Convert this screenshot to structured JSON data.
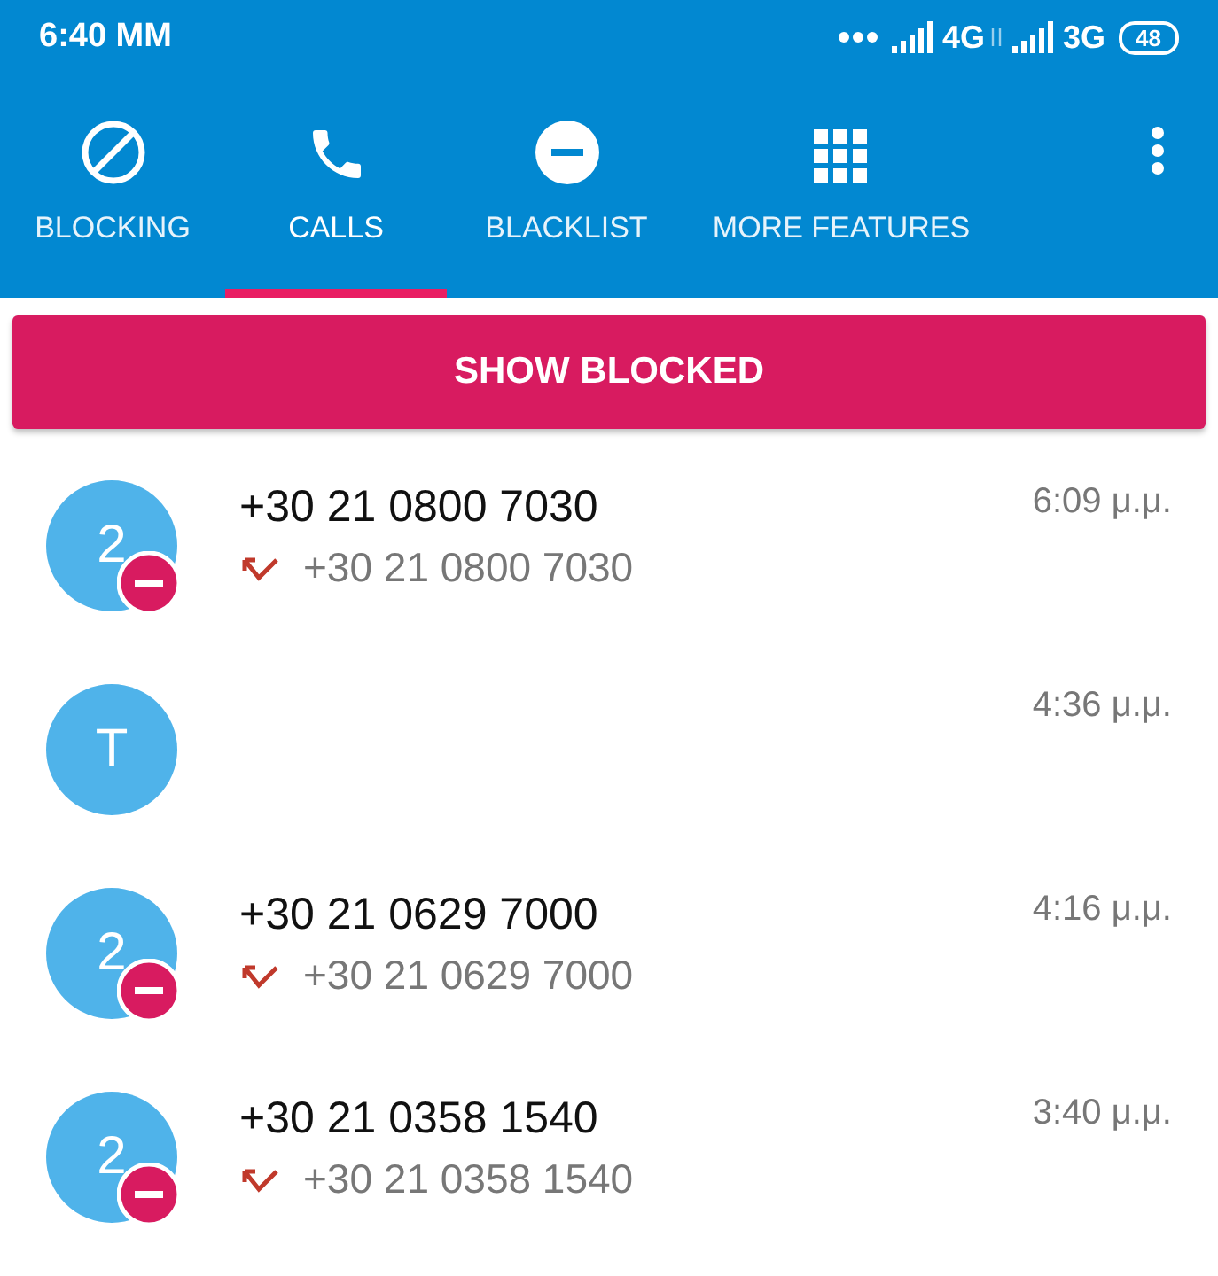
{
  "status_bar": {
    "time": "6:40 MM",
    "network_1": "4G",
    "network_2": "3G",
    "battery": "48"
  },
  "tabs": [
    {
      "label": "BLOCKING",
      "kind": "block",
      "selected": false
    },
    {
      "label": "CALLS",
      "kind": "phone",
      "selected": true
    },
    {
      "label": "BLACKLIST",
      "kind": "minus",
      "selected": false
    },
    {
      "label": "MORE FEATURES",
      "kind": "grid",
      "selected": false
    }
  ],
  "show_blocked_button": "SHOW BLOCKED",
  "calls": [
    {
      "avatar": "2",
      "blocked": true,
      "number": "+30 21 0800 7030",
      "detail": "+30 21 0800 7030",
      "time": "6:09 μ.μ."
    },
    {
      "avatar": "T",
      "blocked": false,
      "time": "4:36 μ.μ."
    },
    {
      "avatar": "2",
      "blocked": true,
      "number": "+30 21 0629 7000",
      "detail": "+30 21 0629 7000",
      "time": "4:16 μ.μ."
    },
    {
      "avatar": "2",
      "blocked": true,
      "number": "+30 21 0358 1540",
      "detail": "+30 21 0358 1540",
      "time": "3:40 μ.μ."
    }
  ]
}
